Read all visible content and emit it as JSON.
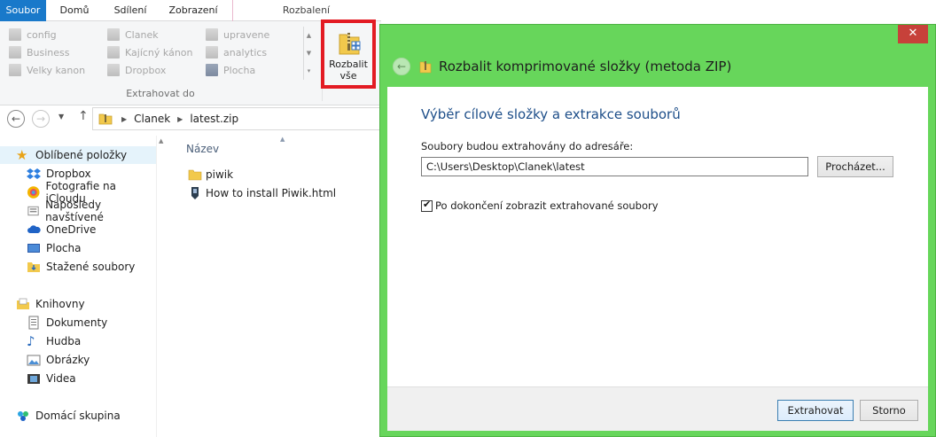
{
  "tabs": {
    "items": [
      "Soubor",
      "Domů",
      "Sdílení",
      "Zobrazení"
    ],
    "contextual": "Rozbalení"
  },
  "ribbon": {
    "locations": [
      "config",
      "Business",
      "Velky kanon",
      "Clanek",
      "Kajícný kánon",
      "Dropbox",
      "upravene",
      "analytics",
      "Plocha"
    ],
    "group_label": "Extrahovat do",
    "extract_all_label": "Rozbalit\nvše"
  },
  "address": {
    "crumbs": [
      "Clanek",
      "latest.zip"
    ]
  },
  "nav": {
    "favorites": [
      "Oblíbené položky",
      "Dropbox",
      "Fotografie na iCloudu",
      "Naposledy navštívené",
      "OneDrive",
      "Plocha",
      "Stažené soubory"
    ],
    "libraries": [
      "Knihovny",
      "Dokumenty",
      "Hudba",
      "Obrázky",
      "Videa"
    ],
    "homegroup": "Domácí skupina"
  },
  "files": {
    "column": "Název",
    "items": [
      "piwik",
      "How to install Piwik.html"
    ]
  },
  "dialog": {
    "title": "Rozbalit komprimované složky (metoda ZIP)",
    "heading": "Výběr cílové složky a extrakce souborů",
    "label": "Soubory budou extrahovány do adresáře:",
    "path": "C:\\Users\\Desktop\\Clanek\\latest",
    "browse": "Procházet...",
    "checkbox_label": "Po dokončení zobrazit extrahované soubory",
    "extract": "Extrahovat",
    "cancel": "Storno",
    "close": "✕",
    "checked": true
  }
}
